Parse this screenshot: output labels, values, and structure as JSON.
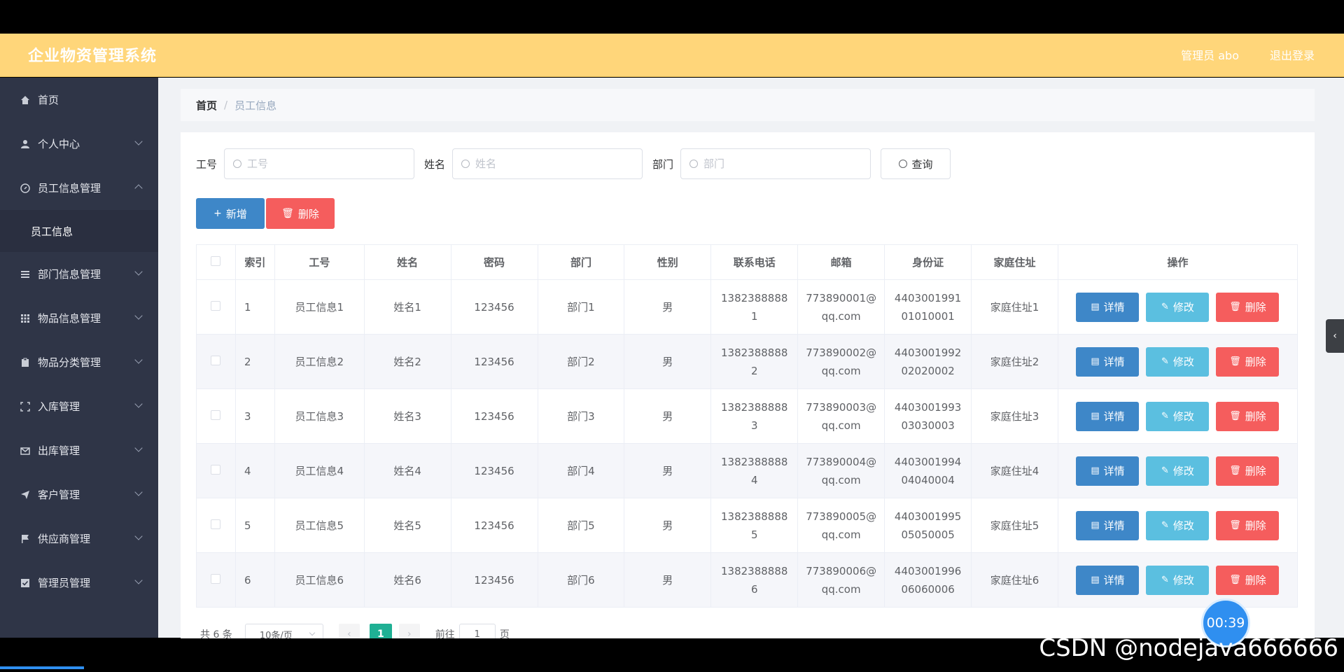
{
  "header": {
    "app_title": "企业物资管理系统",
    "user_label": "管理员 abo",
    "logout_label": "退出登录"
  },
  "sidebar": {
    "items": [
      {
        "label": "首页",
        "icon": "home-icon"
      },
      {
        "label": "个人中心",
        "icon": "user-icon"
      },
      {
        "label": "员工信息管理",
        "icon": "compass-icon"
      },
      {
        "label": "员工信息",
        "icon": ""
      },
      {
        "label": "部门信息管理",
        "icon": "list-icon"
      },
      {
        "label": "物品信息管理",
        "icon": "grid-icon"
      },
      {
        "label": "物品分类管理",
        "icon": "clipboard-icon"
      },
      {
        "label": "入库管理",
        "icon": "frame-icon"
      },
      {
        "label": "出库管理",
        "icon": "mail-icon"
      },
      {
        "label": "客户管理",
        "icon": "send-icon"
      },
      {
        "label": "供应商管理",
        "icon": "flag-icon"
      },
      {
        "label": "管理员管理",
        "icon": "check-square-icon"
      }
    ]
  },
  "breadcrumb": {
    "home": "首页",
    "separator": "/",
    "current": "员工信息"
  },
  "search": {
    "fields": [
      {
        "label": "工号",
        "placeholder": "工号",
        "value": ""
      },
      {
        "label": "姓名",
        "placeholder": "姓名",
        "value": ""
      },
      {
        "label": "部门",
        "placeholder": "部门",
        "value": ""
      }
    ],
    "query_label": "查询"
  },
  "actions": {
    "add_label": "新增",
    "delete_label": "删除"
  },
  "table": {
    "headers": [
      "索引",
      "工号",
      "姓名",
      "密码",
      "部门",
      "性别",
      "联系电话",
      "邮箱",
      "身份证",
      "家庭住址",
      "操作"
    ],
    "rows": [
      {
        "index": "1",
        "id": "员工信息1",
        "name": "姓名1",
        "password": "123456",
        "dept": "部门1",
        "gender": "男",
        "phone_a": "1382388888",
        "phone_b": "1",
        "email_a": "773890001@",
        "email_b": "qq.com",
        "idcard_a": "4403001991",
        "idcard_b": "01010001",
        "address": "家庭住址1"
      },
      {
        "index": "2",
        "id": "员工信息2",
        "name": "姓名2",
        "password": "123456",
        "dept": "部门2",
        "gender": "男",
        "phone_a": "1382388888",
        "phone_b": "2",
        "email_a": "773890002@",
        "email_b": "qq.com",
        "idcard_a": "4403001992",
        "idcard_b": "02020002",
        "address": "家庭住址2"
      },
      {
        "index": "3",
        "id": "员工信息3",
        "name": "姓名3",
        "password": "123456",
        "dept": "部门3",
        "gender": "男",
        "phone_a": "1382388888",
        "phone_b": "3",
        "email_a": "773890003@",
        "email_b": "qq.com",
        "idcard_a": "4403001993",
        "idcard_b": "03030003",
        "address": "家庭住址3"
      },
      {
        "index": "4",
        "id": "员工信息4",
        "name": "姓名4",
        "password": "123456",
        "dept": "部门4",
        "gender": "男",
        "phone_a": "1382388888",
        "phone_b": "4",
        "email_a": "773890004@",
        "email_b": "qq.com",
        "idcard_a": "4403001994",
        "idcard_b": "04040004",
        "address": "家庭住址4"
      },
      {
        "index": "5",
        "id": "员工信息5",
        "name": "姓名5",
        "password": "123456",
        "dept": "部门5",
        "gender": "男",
        "phone_a": "1382388888",
        "phone_b": "5",
        "email_a": "773890005@",
        "email_b": "qq.com",
        "idcard_a": "4403001995",
        "idcard_b": "05050005",
        "address": "家庭住址5"
      },
      {
        "index": "6",
        "id": "员工信息6",
        "name": "姓名6",
        "password": "123456",
        "dept": "部门6",
        "gender": "男",
        "phone_a": "1382388888",
        "phone_b": "6",
        "email_a": "773890006@",
        "email_b": "qq.com",
        "idcard_a": "4403001996",
        "idcard_b": "06060006",
        "address": "家庭住址6"
      }
    ],
    "row_actions": {
      "detail": "详情",
      "edit": "修改",
      "delete": "删除"
    }
  },
  "pagination": {
    "total_label": "共 6 条",
    "page_size": "10条/页",
    "current_page": "1",
    "goto_label": "前往",
    "goto_value": "1",
    "page_unit": "页"
  },
  "overlay": {
    "timer": "00:39",
    "watermark": "CSDN @nodejava666666"
  },
  "colors": {
    "header_bg": "#ffd67a",
    "sidebar_bg": "#2f3547",
    "primary": "#3e87c8",
    "info": "#5bbfe0",
    "danger": "#f55d5d",
    "pager_active": "#1fb094"
  }
}
